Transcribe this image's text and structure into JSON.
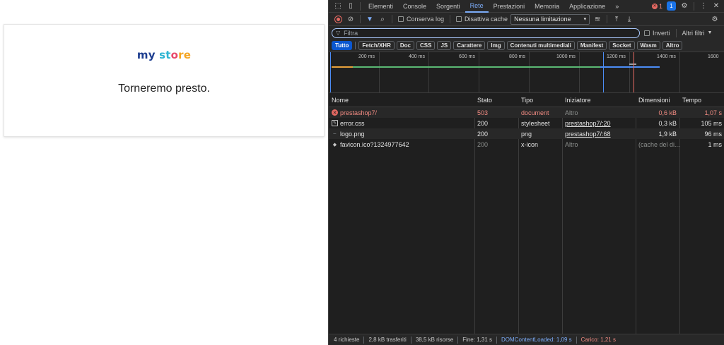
{
  "page": {
    "logo": {
      "part1": "my",
      "part2": "st",
      "part3": "o",
      "part4": "re"
    },
    "message": "Torneremo presto."
  },
  "devtools": {
    "tabs": [
      {
        "label": "Elementi"
      },
      {
        "label": "Console"
      },
      {
        "label": "Sorgenti"
      },
      {
        "label": "Rete"
      },
      {
        "label": "Prestazioni"
      },
      {
        "label": "Memoria"
      },
      {
        "label": "Applicazione"
      }
    ],
    "more_tabs": "»",
    "error_count": "1",
    "blue_badge": "1",
    "toolbar": {
      "preserve_log": "Conserva log",
      "disable_cache": "Disattiva cache",
      "throttling": "Nessuna limitazione"
    },
    "filter": {
      "placeholder": "Filtra",
      "invert": "Inverti",
      "more_filters": "Altri filtri"
    },
    "types": [
      "Tutto",
      "Fetch/XHR",
      "Doc",
      "CSS",
      "JS",
      "Carattere",
      "Img",
      "Contenuti multimediali",
      "Manifest",
      "Socket",
      "Wasm",
      "Altro"
    ],
    "overview_labels": [
      "200 ms",
      "400 ms",
      "600 ms",
      "800 ms",
      "1000 ms",
      "1200 ms",
      "1400 ms",
      "1600"
    ],
    "columns": [
      "Nome",
      "Stato",
      "Tipo",
      "Iniziatore",
      "Dimensioni",
      "Tempo"
    ],
    "rows": [
      {
        "icon": "error",
        "name": "prestashop7/",
        "status": "503",
        "type": "document",
        "initiator": "Altro",
        "size": "0,6 kB",
        "time": "1,07 s"
      },
      {
        "icon": "css",
        "name": "error.css",
        "status": "200",
        "type": "stylesheet",
        "initiator": "prestashop7/:20",
        "size": "0,3 kB",
        "time": "105 ms"
      },
      {
        "icon": "img",
        "name": "logo.png",
        "status": "200",
        "type": "png",
        "initiator": "prestashop7/:68",
        "size": "1,9 kB",
        "time": "96 ms"
      },
      {
        "icon": "fav",
        "name": "favicon.ico?1324977642",
        "status": "200",
        "type": "x-icon",
        "initiator": "Altro",
        "size": "(cache del di...",
        "time": "1 ms"
      }
    ],
    "status": {
      "requests": "4 richieste",
      "transferred": "2,8 kB trasferiti",
      "resources": "38,5 kB risorse",
      "finish": "Fine: 1,31 s",
      "dcl": "DOMContentLoaded: 1,09 s",
      "load": "Carico: 1,21 s"
    },
    "colors": {
      "accent": "#7cacf8",
      "error": "#f28b82",
      "active_chip": "#0b57d0"
    }
  }
}
